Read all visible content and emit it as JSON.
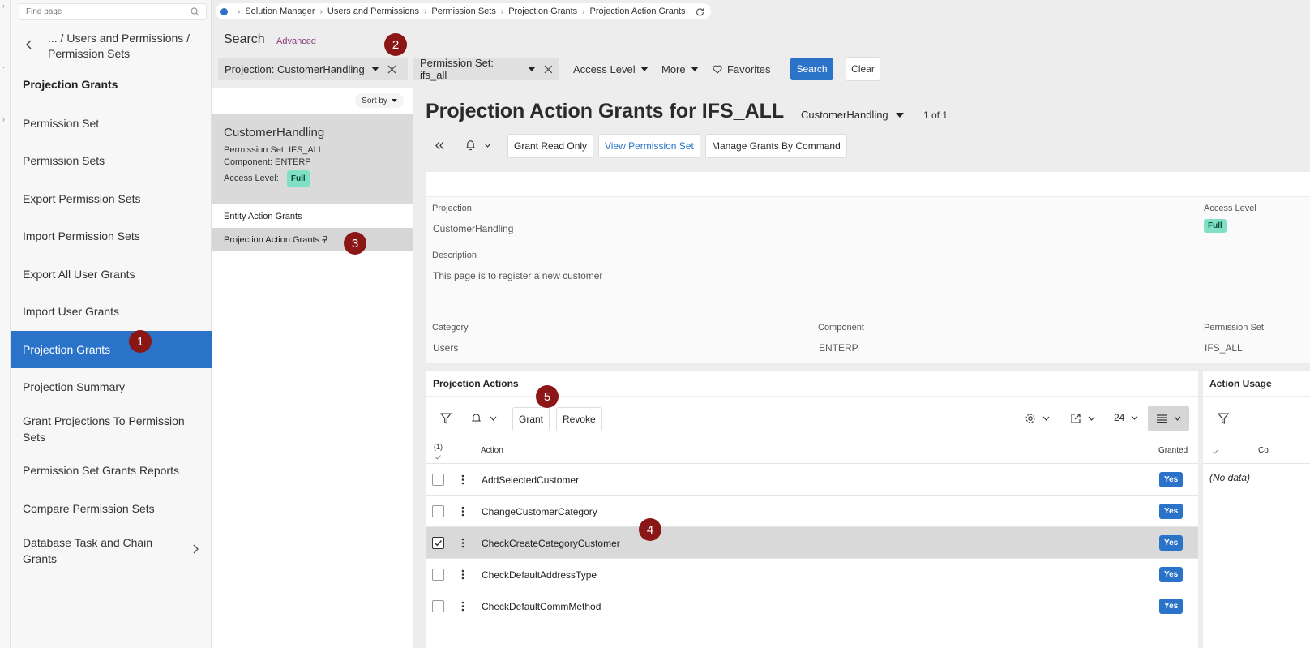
{
  "navigator": {
    "search_placeholder": "Find page",
    "crumb": "... / Users and Permissions / Permission Sets",
    "current": "Projection Grants",
    "items": [
      {
        "label": "Permission Set"
      },
      {
        "label": "Permission Sets"
      },
      {
        "label": "Export Permission Sets"
      },
      {
        "label": "Import Permission Sets"
      },
      {
        "label": "Export All User Grants"
      },
      {
        "label": "Import User Grants"
      },
      {
        "label": "Projection Grants",
        "active": true
      },
      {
        "label": "Projection Summary"
      },
      {
        "label": "Grant Projections To Permission Sets"
      },
      {
        "label": "Permission Set Grants Reports"
      },
      {
        "label": "Compare Permission Sets"
      },
      {
        "label": "Database Task and Chain Grants",
        "has_children": true
      }
    ]
  },
  "breadcrumb": [
    "Solution Manager",
    "Users and Permissions",
    "Permission Sets",
    "Projection Grants",
    "Projection Action Grants"
  ],
  "search": {
    "title": "Search",
    "advanced": "Advanced",
    "chips": [
      "Projection: CustomerHandling",
      "Permission Set: ifs_all"
    ],
    "access_level": "Access Level",
    "more": "More",
    "favorites": "Favorites",
    "search_button": "Search",
    "clear_button": "Clear"
  },
  "list": {
    "sort_by": "Sort by",
    "card": {
      "title": "CustomerHandling",
      "permission_set_label": "Permission Set:",
      "permission_set": "IFS_ALL",
      "component_label": "Component:",
      "component": "ENTERP",
      "access_level_label": "Access Level:",
      "access_level": "Full"
    },
    "items": [
      "Entity Action Grants",
      "Projection Action Grants"
    ]
  },
  "detail": {
    "title": "Projection Action Grants for IFS_ALL",
    "selector": "CustomerHandling",
    "counter": "1 of 1",
    "commands": [
      "Grant Read Only",
      "View Permission Set",
      "Manage Grants By Command"
    ],
    "fields": {
      "projection_label": "Projection",
      "projection": "CustomerHandling",
      "access_level_label": "Access Level",
      "access_level": "Full",
      "description_label": "Description",
      "description": "This page is to register a new customer",
      "category_label": "Category",
      "category": "Users",
      "component_label": "Component",
      "component": "ENTERP",
      "permission_set_label": "Permission Set",
      "permission_set": "IFS_ALL"
    }
  },
  "grid": {
    "title": "Projection Actions",
    "grant": "Grant",
    "revoke": "Revoke",
    "page_size": "24",
    "selected_count": "(1)",
    "col_action": "Action",
    "col_granted": "Granted",
    "rows": [
      {
        "action": "AddSelectedCustomer",
        "granted": "Yes",
        "selected": false
      },
      {
        "action": "ChangeCustomerCategory",
        "granted": "Yes",
        "selected": false
      },
      {
        "action": "CheckCreateCategoryCustomer",
        "granted": "Yes",
        "selected": true
      },
      {
        "action": "CheckDefaultAddressType",
        "granted": "Yes",
        "selected": false
      },
      {
        "action": "CheckDefaultCommMethod",
        "granted": "Yes",
        "selected": false
      }
    ]
  },
  "usage": {
    "title": "Action Usage",
    "col": "Co",
    "no_data": "(No data)"
  },
  "markers": [
    "1",
    "2",
    "3",
    "4",
    "5"
  ],
  "colors": {
    "accent": "#2a73c9",
    "marker": "#8a1616",
    "full_badge": "#7fe0c5"
  }
}
